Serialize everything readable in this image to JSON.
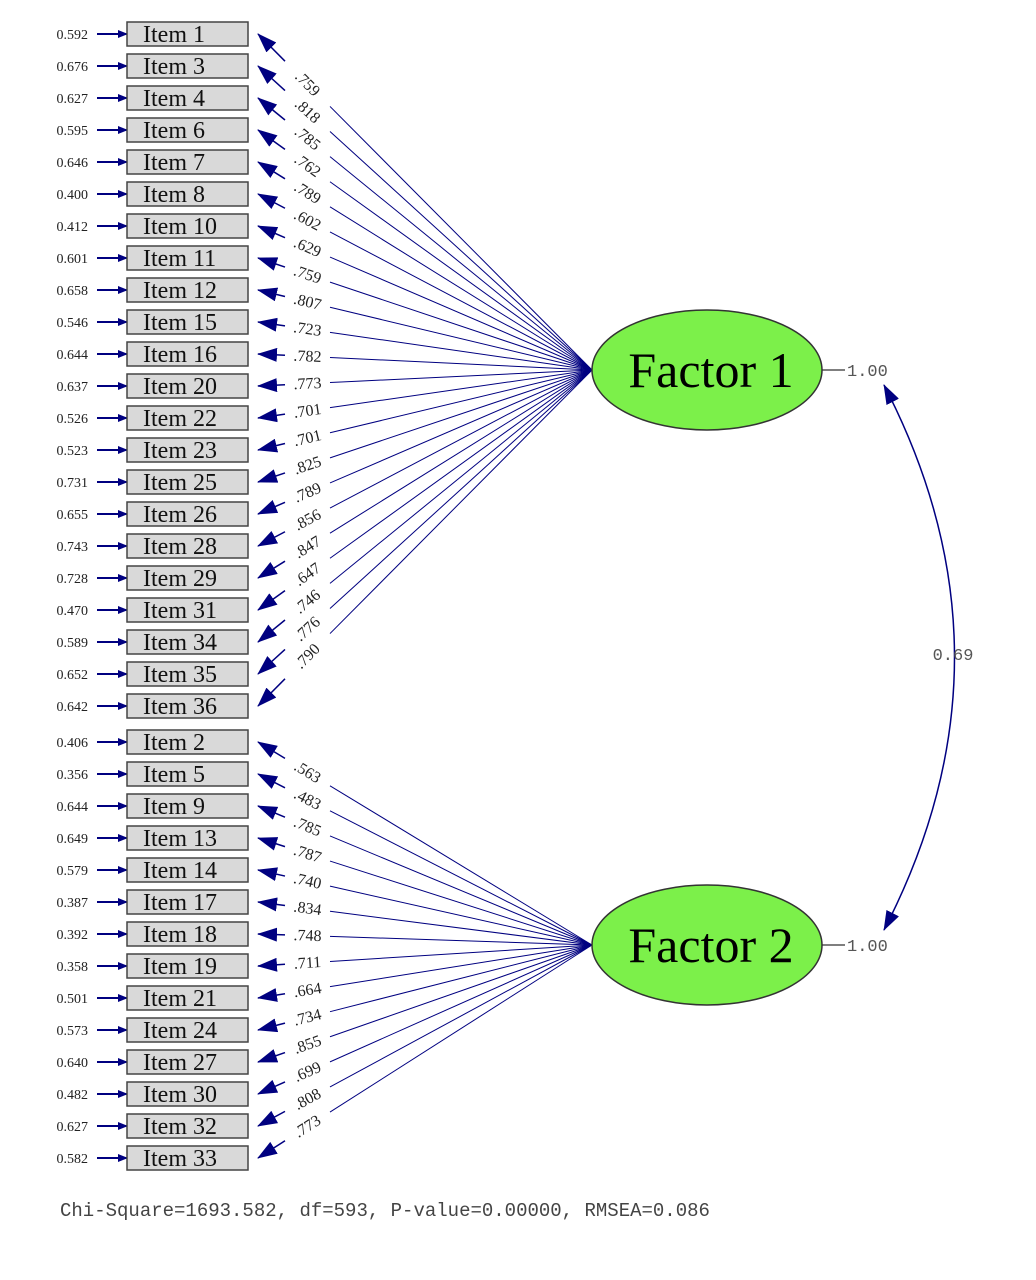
{
  "colors": {
    "path": "#000080",
    "factor_fill": "#7CF04A",
    "box_fill": "#d9d9d9"
  },
  "factors": [
    {
      "label": "Factor 1",
      "variance": "1.00",
      "items": [
        {
          "name": "Item 1",
          "error": "0.592",
          "loading": ".759"
        },
        {
          "name": "Item 3",
          "error": "0.676",
          "loading": ".818"
        },
        {
          "name": "Item 4",
          "error": "0.627",
          "loading": ".785"
        },
        {
          "name": "Item 6",
          "error": "0.595",
          "loading": ".762"
        },
        {
          "name": "Item 7",
          "error": "0.646",
          "loading": ".789"
        },
        {
          "name": "Item 8",
          "error": "0.400",
          "loading": ".602"
        },
        {
          "name": "Item 10",
          "error": "0.412",
          "loading": ".629"
        },
        {
          "name": "Item 11",
          "error": "0.601",
          "loading": ".759"
        },
        {
          "name": "Item 12",
          "error": "0.658",
          "loading": ".807"
        },
        {
          "name": "Item 15",
          "error": "0.546",
          "loading": ".723"
        },
        {
          "name": "Item 16",
          "error": "0.644",
          "loading": ".782"
        },
        {
          "name": "Item 20",
          "error": "0.637",
          "loading": ".773"
        },
        {
          "name": "Item 22",
          "error": "0.526",
          "loading": ".701"
        },
        {
          "name": "Item 23",
          "error": "0.523",
          "loading": ".701"
        },
        {
          "name": "Item 25",
          "error": "0.731",
          "loading": ".825"
        },
        {
          "name": "Item 26",
          "error": "0.655",
          "loading": ".789"
        },
        {
          "name": "Item 28",
          "error": "0.743",
          "loading": ".856"
        },
        {
          "name": "Item 29",
          "error": "0.728",
          "loading": ".847"
        },
        {
          "name": "Item 31",
          "error": "0.470",
          "loading": ".647"
        },
        {
          "name": "Item 34",
          "error": "0.589",
          "loading": ".746"
        },
        {
          "name": "Item 35",
          "error": "0.652",
          "loading": ".776"
        },
        {
          "name": "Item 36",
          "error": "0.642",
          "loading": ".790"
        }
      ]
    },
    {
      "label": "Factor 2",
      "variance": "1.00",
      "items": [
        {
          "name": "Item 2",
          "error": "0.406",
          "loading": ".563"
        },
        {
          "name": "Item 5",
          "error": "0.356",
          "loading": ".483"
        },
        {
          "name": "Item 9",
          "error": "0.644",
          "loading": ".785"
        },
        {
          "name": "Item 13",
          "error": "0.649",
          "loading": ".787"
        },
        {
          "name": "Item 14",
          "error": "0.579",
          "loading": ".740"
        },
        {
          "name": "Item 17",
          "error": "0.387",
          "loading": ".834"
        },
        {
          "name": "Item 18",
          "error": "0.392",
          "loading": ".748"
        },
        {
          "name": "Item 19",
          "error": "0.358",
          "loading": ".711"
        },
        {
          "name": "Item 21",
          "error": "0.501",
          "loading": ".664"
        },
        {
          "name": "Item 24",
          "error": "0.573",
          "loading": ".734"
        },
        {
          "name": "Item 27",
          "error": "0.640",
          "loading": ".855"
        },
        {
          "name": "Item 30",
          "error": "0.482",
          "loading": ".699"
        },
        {
          "name": "Item 32",
          "error": "0.627",
          "loading": ".808"
        },
        {
          "name": "Item 33",
          "error": "0.582",
          "loading": ".773"
        }
      ]
    }
  ],
  "correlation": "0.69",
  "fit": "Chi-Square=1693.582, df=593, P-value=0.00000, RMSEA=0.086"
}
